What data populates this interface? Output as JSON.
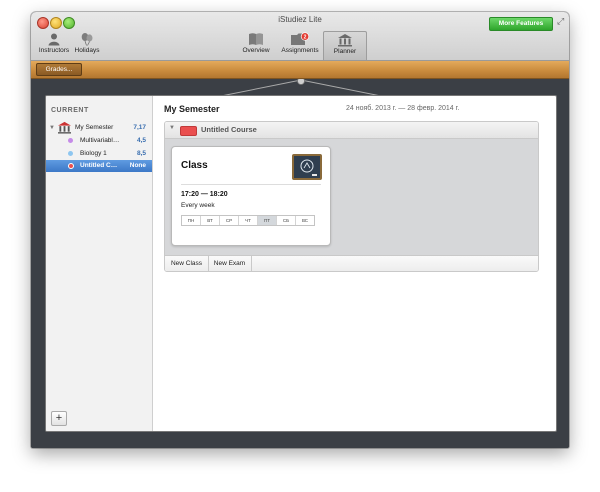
{
  "window": {
    "title": "iStudiez Lite",
    "more_features": "More Features"
  },
  "toolbar": {
    "instructors": "Instructors",
    "holidays": "Holidays",
    "overview": "Overview",
    "assignments": "Assignments",
    "assignments_badge": "2",
    "planner": "Planner"
  },
  "grades_button": "Grades...",
  "sidebar": {
    "heading": "CURRENT",
    "semester": {
      "name": "My Semester",
      "score": "7,17"
    },
    "courses": [
      {
        "name": "Multivariabl…",
        "score": "4,5",
        "color": "#c58be8"
      },
      {
        "name": "Biology 1",
        "score": "8,5",
        "color": "#8ec6f0"
      },
      {
        "name": "Untitled C…",
        "score": "None",
        "color": "#ea4f4f"
      }
    ],
    "add_label": "+"
  },
  "main": {
    "semester_title": "My Semester",
    "date_range": "24 нояб. 2013 г. — 28 февр. 2014 г.",
    "course": {
      "name": "Untitled Course",
      "color": "#ea4f4f",
      "class_card": {
        "title": "Class",
        "time": "17:20 — 18:20",
        "repeat": "Every week",
        "days": [
          "ПН",
          "ВТ",
          "СР",
          "ЧТ",
          "ПТ",
          "СБ",
          "ВС"
        ],
        "active_day": "ПТ"
      },
      "buttons": {
        "new_class": "New Class",
        "new_exam": "New Exam"
      }
    }
  }
}
